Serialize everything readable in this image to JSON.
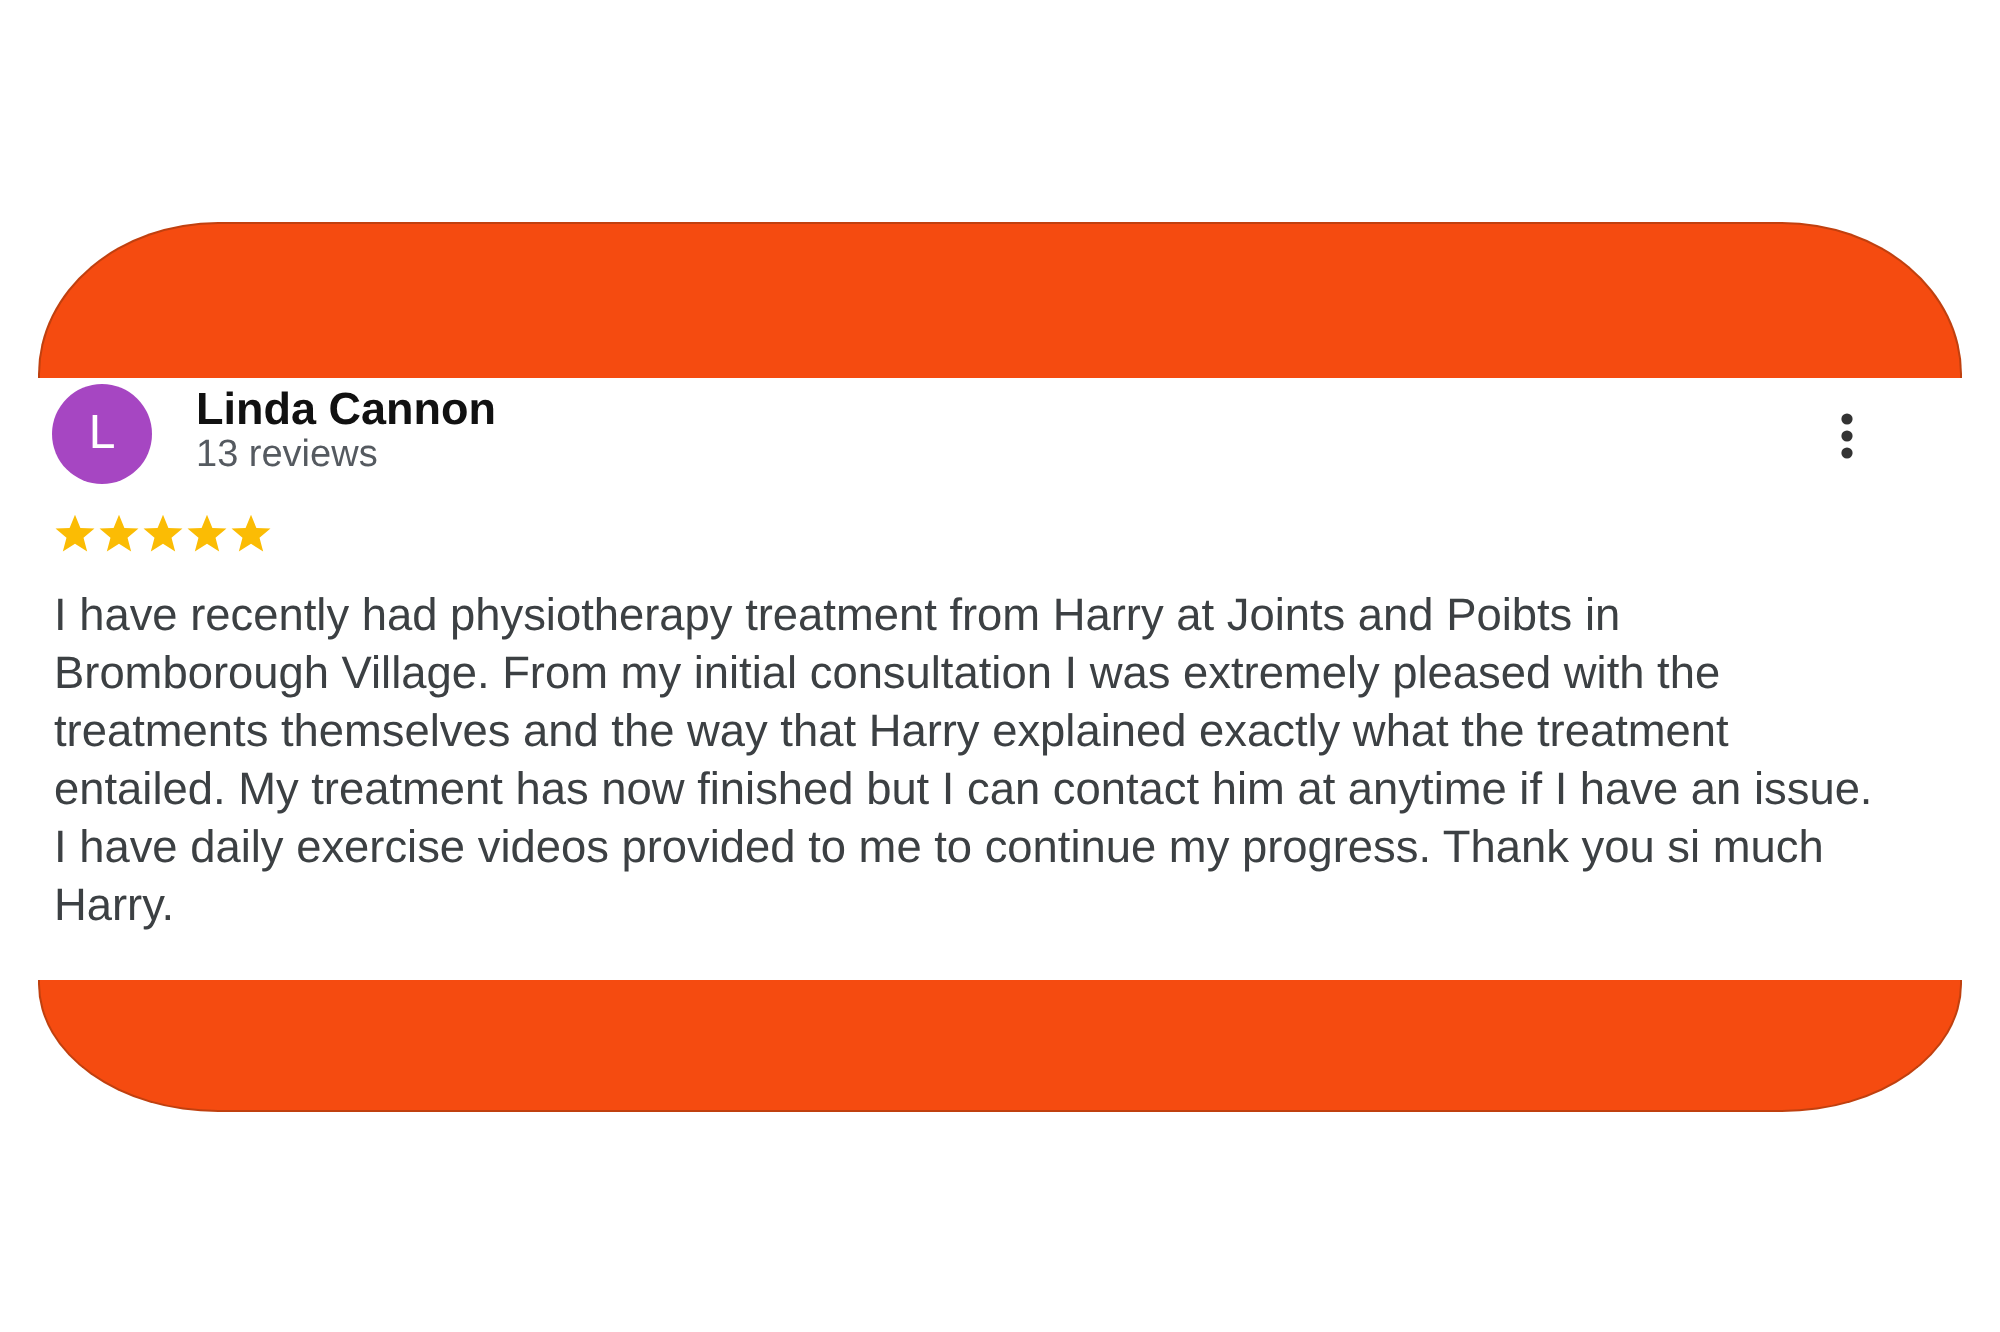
{
  "review": {
    "author": {
      "initial": "L",
      "name": "Linda Cannon",
      "review_count": "13 reviews"
    },
    "stars": 5,
    "text": "I have recently had physiotherapy treatment from Harry at Joints and Poibts in Bromborough Village. From my initial consultation I was extremely pleased with the treatments themselves and the way that Harry explained exactly what the treatment entailed. My treatment has now finished but I can contact him at anytime if I have an issue. I have daily exercise videos provided to me to continue my progress. Thank you si much Harry."
  }
}
